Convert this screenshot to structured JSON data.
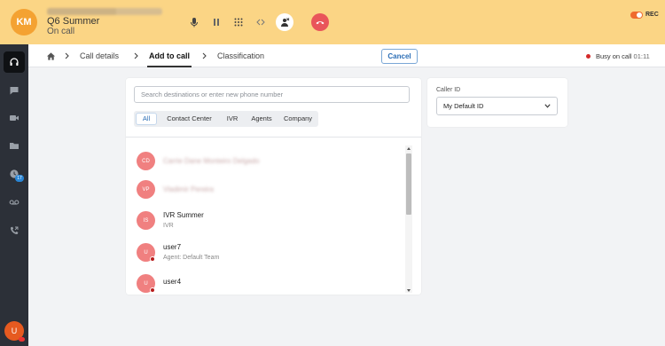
{
  "call": {
    "avatar_initials": "KM",
    "caller_name": "Q6 Summer",
    "status": "On call",
    "rec_label": "REC"
  },
  "controls": [
    {
      "icon": "microphone-icon"
    },
    {
      "icon": "pause-icon"
    },
    {
      "icon": "dialpad-icon"
    },
    {
      "icon": "transfer-icon"
    },
    {
      "icon": "no-answer-icon"
    },
    {
      "icon": "hangup-icon"
    }
  ],
  "sidebar": {
    "items": [
      {
        "icon": "headset-icon",
        "active": true
      },
      {
        "icon": "chat-icon"
      },
      {
        "icon": "video-icon"
      },
      {
        "icon": "folder-icon"
      },
      {
        "icon": "history-icon",
        "badge": "17"
      },
      {
        "icon": "voicemail-icon"
      },
      {
        "icon": "callback-icon"
      }
    ],
    "user_initial": "U"
  },
  "breadcrumb": {
    "items": [
      "Call details",
      "Add to call",
      "Classification"
    ],
    "active_index": 1,
    "cancel_label": "Cancel"
  },
  "status": {
    "label": "Busy on call",
    "time": "01:11"
  },
  "search": {
    "placeholder": "Search destinations or enter new phone number",
    "value": ""
  },
  "tabs": [
    {
      "label": "All",
      "active": true
    },
    {
      "label": "Contact Center"
    },
    {
      "label": "IVR"
    },
    {
      "label": "Agents"
    },
    {
      "label": "Company"
    }
  ],
  "results": [
    {
      "initials": "CD",
      "name": "Carrie Dane Monteiro Delgado",
      "sub": "",
      "blurred": true
    },
    {
      "initials": "VP",
      "name": "Vladimir Pereira",
      "sub": "",
      "blurred": true
    },
    {
      "initials": "IS",
      "name": "IVR Summer",
      "sub": "IVR"
    },
    {
      "initials": "U",
      "name": "user7",
      "sub": "Agent: Default Team",
      "presence": "busy"
    },
    {
      "initials": "U",
      "name": "user4",
      "sub": "",
      "presence": "busy"
    }
  ],
  "caller_id": {
    "label": "Caller ID",
    "selected": "My Default ID"
  },
  "colors": {
    "topbar": "#fbd585",
    "hangup": "#e9555a",
    "accent": "#2a6db5",
    "result_avatar": "#f08080",
    "busy": "#d42a2a"
  }
}
